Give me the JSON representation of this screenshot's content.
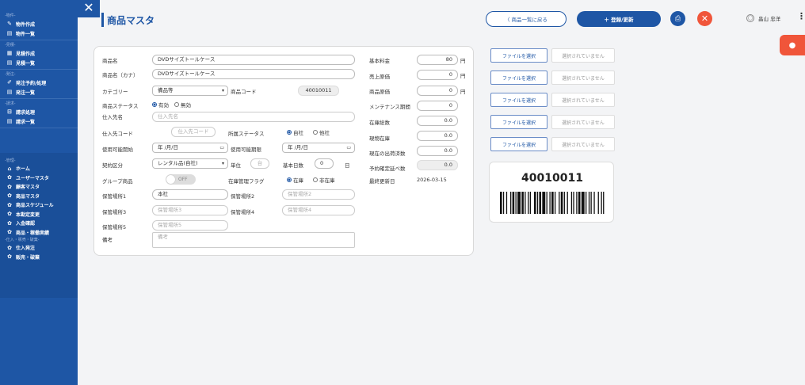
{
  "sidebar": {
    "sections": [
      {
        "label": "-物件-",
        "items": [
          {
            "label": "物件作成",
            "icon": "pencil-icon"
          },
          {
            "label": "物件一覧",
            "icon": "list-icon"
          }
        ]
      },
      {
        "label": "-見積-",
        "items": [
          {
            "label": "見積作成",
            "icon": "document-icon"
          },
          {
            "label": "見積一覧",
            "icon": "list-icon"
          }
        ]
      },
      {
        "label": "-発注-",
        "items": [
          {
            "label": "発注予約/処理",
            "icon": "cart-icon"
          },
          {
            "label": "発注一覧",
            "icon": "list-icon"
          }
        ]
      },
      {
        "label": "-請求-",
        "items": [
          {
            "label": "請求処理",
            "icon": "invoice-icon"
          },
          {
            "label": "請求一覧",
            "icon": "list-icon"
          }
        ]
      }
    ],
    "admin_label": "-管理-",
    "admin_items": [
      {
        "label": "ホーム",
        "icon": "home-icon"
      },
      {
        "label": "ユーザーマスタ",
        "icon": "gear-icon"
      },
      {
        "label": "顧客マスタ",
        "icon": "gear-icon"
      },
      {
        "label": "商品マスタ",
        "icon": "gear-icon"
      },
      {
        "label": "商品スケジュール",
        "icon": "gear-icon"
      },
      {
        "label": "本勘定変更",
        "icon": "gear-icon"
      },
      {
        "label": "入金確認",
        "icon": "gear-icon"
      },
      {
        "label": "商品・稼働実績",
        "icon": "gear-icon"
      }
    ],
    "sub_label": "-仕入・販売・破棄-",
    "sub_items": [
      {
        "label": "仕入発注",
        "icon": "gear-icon"
      },
      {
        "label": "販売・破棄",
        "icon": "gear-icon"
      }
    ]
  },
  "header": {
    "title": "商品マスタ",
    "back_label": "〈 商品一覧に戻る",
    "save_label": "＋ 登録/更新",
    "user_name": "畠山 忠洋"
  },
  "form": {
    "product_name_label": "商品名",
    "product_name": "DVDサイズトールケース",
    "product_kana_label": "商品名（カナ）",
    "product_kana": "DVDサイズトールケース",
    "category_label": "カテゴリー",
    "category": "備品等",
    "product_code_label": "商品コード",
    "product_code": "40010011",
    "status_label": "商品ステータス",
    "status_options": [
      "有効",
      "無効"
    ],
    "supplier_label": "仕入先名",
    "supplier_placeholder": "仕入先名",
    "supplier_code_label": "仕入先コード",
    "supplier_code_placeholder": "仕入先コード",
    "owner_status_label": "所属ステータス",
    "owner_options": [
      "自社",
      "他社"
    ],
    "use_start_label": "使用可能開始",
    "use_start": "年 /月/日",
    "use_end_label": "使用可能期限",
    "use_end": "年 /月/日",
    "contract_label": "契約区分",
    "contract": "レンタル品(自社)",
    "unit_label": "単位",
    "unit_value": "台",
    "base_days_label": "基本日数",
    "base_days": "0",
    "base_days_unit": "日",
    "group_label": "グループ商品",
    "group_toggle": "OFF",
    "stock_flag_label": "在庫管理フラグ",
    "stock_options": [
      "在庫",
      "非在庫"
    ],
    "storage1_label": "保管場所1",
    "storage1": "本社",
    "storage2_label": "保管場所2",
    "storage2_placeholder": "保管場所2",
    "storage3_label": "保管場所3",
    "storage3_placeholder": "保管場所3",
    "storage4_label": "保管場所4",
    "storage4_placeholder": "保管場所4",
    "storage5_label": "保管場所5",
    "storage5_placeholder": "保管場所5",
    "notes_label": "備考",
    "notes_placeholder": "備考"
  },
  "pricing": {
    "base_fee_label": "基本料金",
    "base_fee": "80",
    "yen": "円",
    "sell_price_label": "売上原価",
    "sell_price": "0",
    "cost_label": "商品原価",
    "cost": "0",
    "maintenance_label": "メンテナンス期間",
    "maintenance": "0",
    "stock_total_label": "在庫総数",
    "stock_total": "0.0",
    "current_stock_label": "現物在庫",
    "current_stock": "0.0",
    "out_count_label": "現在の出荷済数",
    "out_count": "0.0",
    "reserved_label": "予約確定延べ数",
    "reserved": "0.0",
    "updated_label": "最終更新日",
    "updated": "2026-03-15"
  },
  "files": {
    "choose_label": "ファイルを選択",
    "none_label": "選択されていません",
    "count": 5
  },
  "barcode": {
    "number": "40010011"
  }
}
